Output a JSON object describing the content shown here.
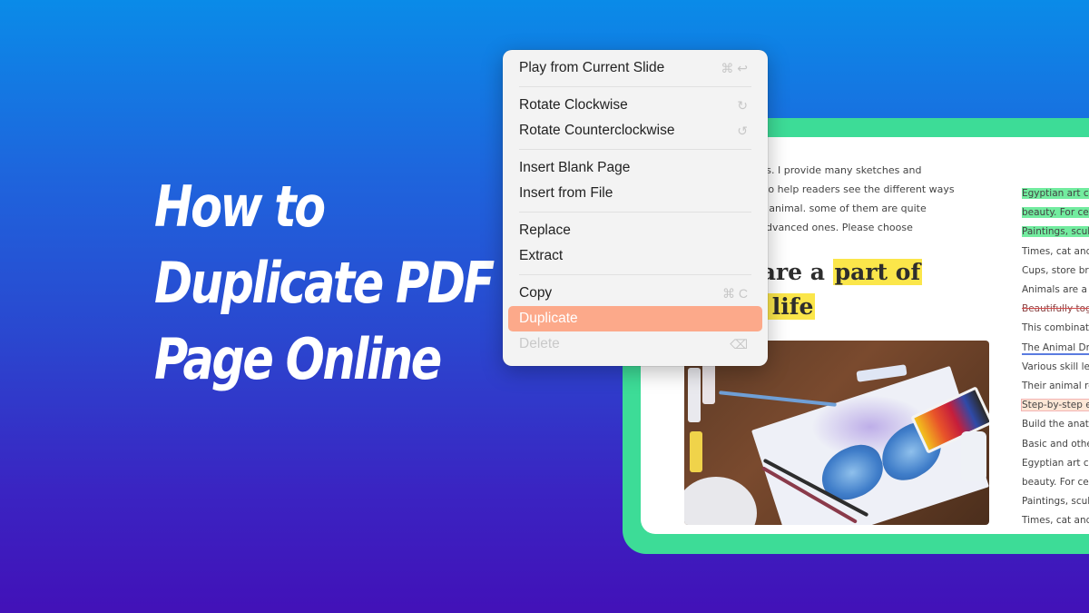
{
  "headline": {
    "lines": [
      "How to",
      "Duplicate PDF",
      "Page Online"
    ]
  },
  "colors": {
    "frame_accent": "#3ddc97",
    "menu_active": "#fca98a",
    "highlight_yellow": "#fbe64a",
    "highlight_green": "#72ec9f"
  },
  "document": {
    "paragraph": [
      "erings. I provide many sketches and",
      "ples to help readers see the different ways",
      "of an animal. some of them are quite",
      "ore advanced ones. Please choose"
    ],
    "heading": {
      "line1_plain": "s are a ",
      "line1_highlight": "part of",
      "line2_highlight": "ly life"
    },
    "photo_alt": "watercolor butterfly painting on table with paints and brushes",
    "right_column": [
      "Egyptian art ce",
      "beauty. For cer",
      "Paintings, scul",
      "Times, cat and",
      "Cups, store bra",
      "Animals are a p",
      "Beautifully tog",
      "This combinati",
      "The Animal Dra",
      "Various skill le",
      "Their animal re",
      "Step-by-step ex",
      "Build the anato",
      "Basic and othe",
      "Egyptian art ce",
      "beauty. For cer",
      "Paintings, scul",
      "Times, cat and"
    ]
  },
  "context_menu": {
    "groups": [
      [
        {
          "label": "Play from Current Slide",
          "shortcut": "⌘ ↩",
          "state": "normal"
        }
      ],
      [
        {
          "label": "Rotate Clockwise",
          "shortcut": "↻",
          "state": "normal"
        },
        {
          "label": "Rotate Counterclockwise",
          "shortcut": "↺",
          "state": "normal"
        }
      ],
      [
        {
          "label": "Insert Blank Page",
          "shortcut": "",
          "state": "normal"
        },
        {
          "label": "Insert from File",
          "shortcut": "",
          "state": "normal"
        }
      ],
      [
        {
          "label": "Replace",
          "shortcut": "",
          "state": "normal"
        },
        {
          "label": "Extract",
          "shortcut": "",
          "state": "normal"
        }
      ],
      [
        {
          "label": "Copy",
          "shortcut": "⌘ C",
          "state": "normal"
        },
        {
          "label": "Duplicate",
          "shortcut": "",
          "state": "active"
        },
        {
          "label": "Delete",
          "shortcut": "⌫",
          "state": "disabled"
        }
      ]
    ]
  }
}
